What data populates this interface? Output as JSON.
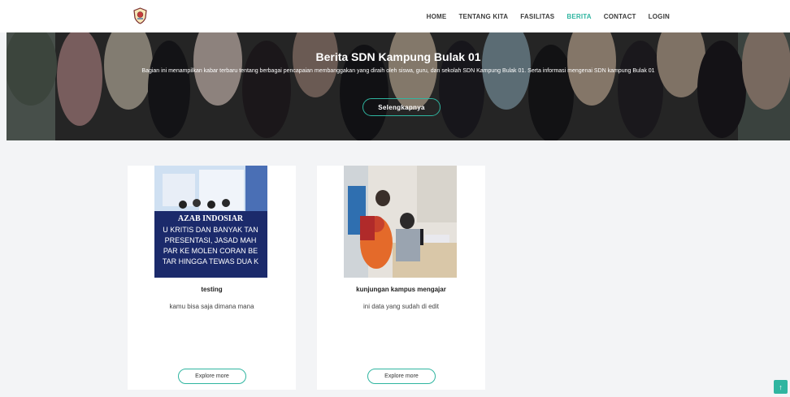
{
  "nav": {
    "items": [
      {
        "label": "HOME",
        "active": false
      },
      {
        "label": "TENTANG KITA",
        "active": false
      },
      {
        "label": "FASILITAS",
        "active": false
      },
      {
        "label": "BERITA",
        "active": true
      },
      {
        "label": "CONTACT",
        "active": false
      },
      {
        "label": "LOGIN",
        "active": false
      }
    ]
  },
  "hero": {
    "title": "Berita SDN Kampung Bulak 01",
    "description": "Bagian ini menampilkan kabar terbaru tentang berbagai pencapaian membanggakan yang diraih oleh siswa, guru, dan sekolah SDN Kampung Bulak 01. Serta informasi mengenai SDN kampung Bulak 01",
    "button_label": "Selengkapnya"
  },
  "cards": [
    {
      "title": "testing",
      "description": "kamu bisa saja dimana mana",
      "button_label": "Explore more",
      "image_text": {
        "brand": "AZAB INDOSIAR",
        "lines": [
          "U KRITIS DAN BANYAK TAN",
          "PRESENTASI, JASAD MAH",
          "PAR KE MOLEN CORAN BE",
          "TAR HINGGA TEWAS DUA K"
        ]
      }
    },
    {
      "title": "kunjungan kampus mengajar",
      "description": "ini data yang sudah di edit",
      "button_label": "Explore more"
    }
  ],
  "colors": {
    "accent": "#2fb5a0",
    "page_bg": "#f3f4f6",
    "card_bg": "#ffffff"
  },
  "icons": {
    "logo": "school-emblem-icon",
    "scroll_top": "arrow-up-icon"
  }
}
